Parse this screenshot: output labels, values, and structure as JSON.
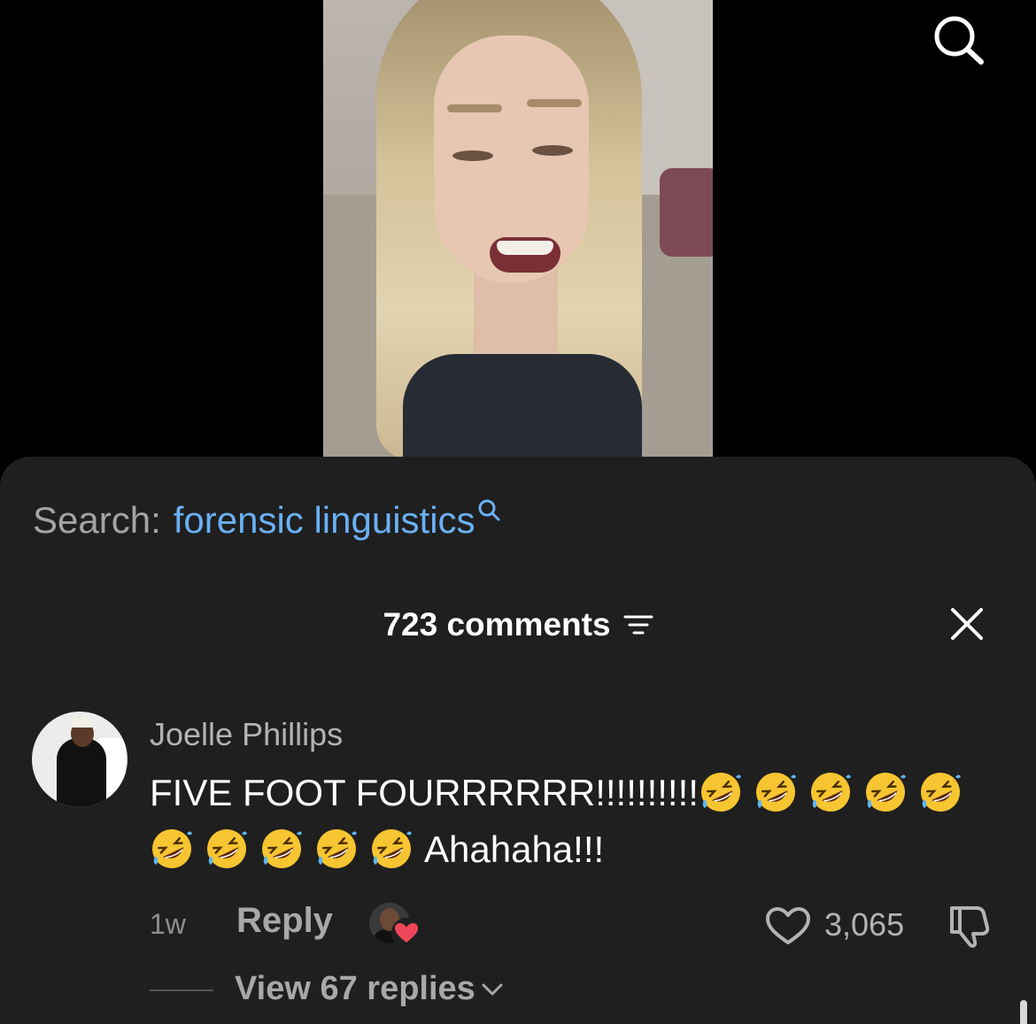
{
  "video": {
    "description_icon": "video-thumbnail"
  },
  "search": {
    "prefix": "Search:",
    "term": "forensic linguistics"
  },
  "comments": {
    "count_label": "723 comments"
  },
  "comment": {
    "author": "Joelle Phillips",
    "text_line1": "FIVE FOOT FOURRRRRR!!!!!!!!!!",
    "text_tail": "Ahahaha!!!",
    "emoji_count": 10,
    "time": "1w",
    "reply_label": "Reply",
    "likes": "3,065",
    "view_replies": "View 67 replies"
  },
  "colors": {
    "sheet_bg": "#1f1f1f",
    "link_blue": "#6ab0f5",
    "heart_red": "#f0465a"
  }
}
